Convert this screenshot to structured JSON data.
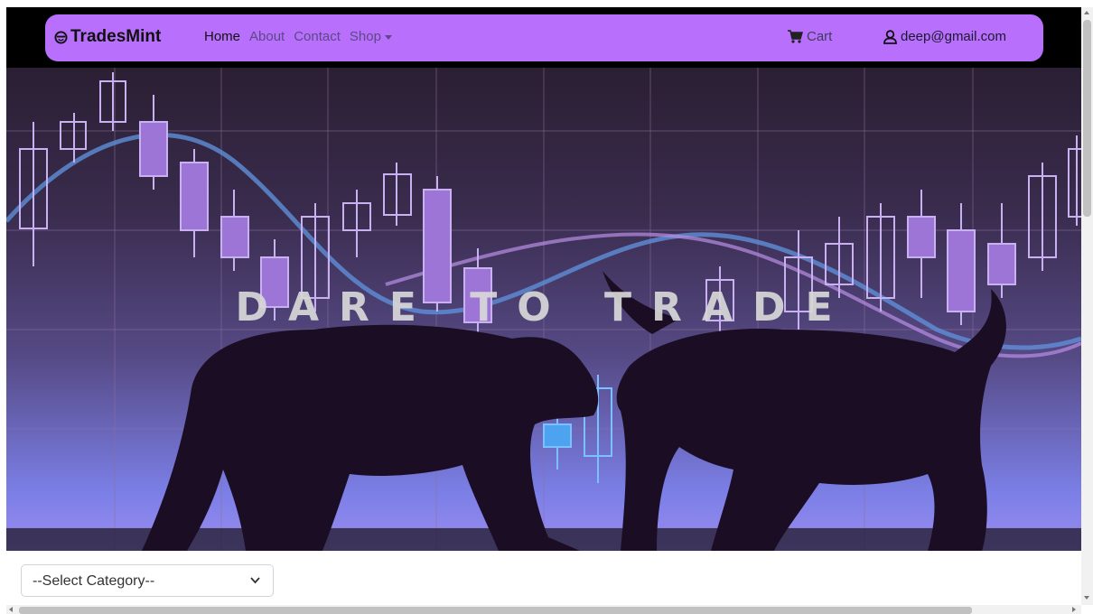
{
  "navbar": {
    "brand": "TradesMint",
    "links": [
      {
        "label": "Home",
        "active": true
      },
      {
        "label": "About",
        "active": false
      },
      {
        "label": "Contact",
        "active": false
      },
      {
        "label": "Shop",
        "active": false
      }
    ],
    "cart_label": "Cart",
    "user_email": "deep@gmail.com",
    "accent_color": "#b86ffc"
  },
  "hero": {
    "title": "DARE TO TRADE"
  },
  "filter": {
    "selected": "--Select Category--"
  },
  "icons": [
    "smiley-logo-icon",
    "cart-icon",
    "user-icon",
    "chevron-down-icon",
    "caret-down-icon"
  ]
}
